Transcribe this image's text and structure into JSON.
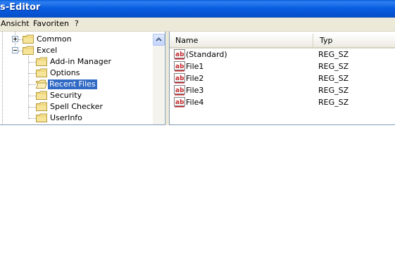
{
  "window": {
    "title": "s-Editor"
  },
  "menu": {
    "items": [
      "Ansicht",
      "Favoriten",
      "?"
    ]
  },
  "tree": {
    "nodes": [
      {
        "label": "Common",
        "expander": "plus",
        "selected": false
      },
      {
        "label": "Excel",
        "expander": "minus",
        "selected": false
      },
      {
        "label": "Add-in Manager",
        "selected": false
      },
      {
        "label": "Options",
        "selected": false
      },
      {
        "label": "Recent Files",
        "selected": true
      },
      {
        "label": "Security",
        "selected": false
      },
      {
        "label": "Spell Checker",
        "selected": false
      },
      {
        "label": "UserInfo",
        "selected": false
      }
    ]
  },
  "list": {
    "columns": [
      "Name",
      "Typ"
    ],
    "rows": [
      {
        "name": "(Standard)",
        "type": "REG_SZ"
      },
      {
        "name": "File1",
        "type": "REG_SZ"
      },
      {
        "name": "File2",
        "type": "REG_SZ"
      },
      {
        "name": "File3",
        "type": "REG_SZ"
      },
      {
        "name": "File4",
        "type": "REG_SZ"
      }
    ],
    "value_icon": "ab-string-value-icon"
  },
  "colors": {
    "titlebar": "#0a5fe2",
    "selection": "#316ac5",
    "chrome": "#ece9d8",
    "icon_red": "#c0262b"
  }
}
